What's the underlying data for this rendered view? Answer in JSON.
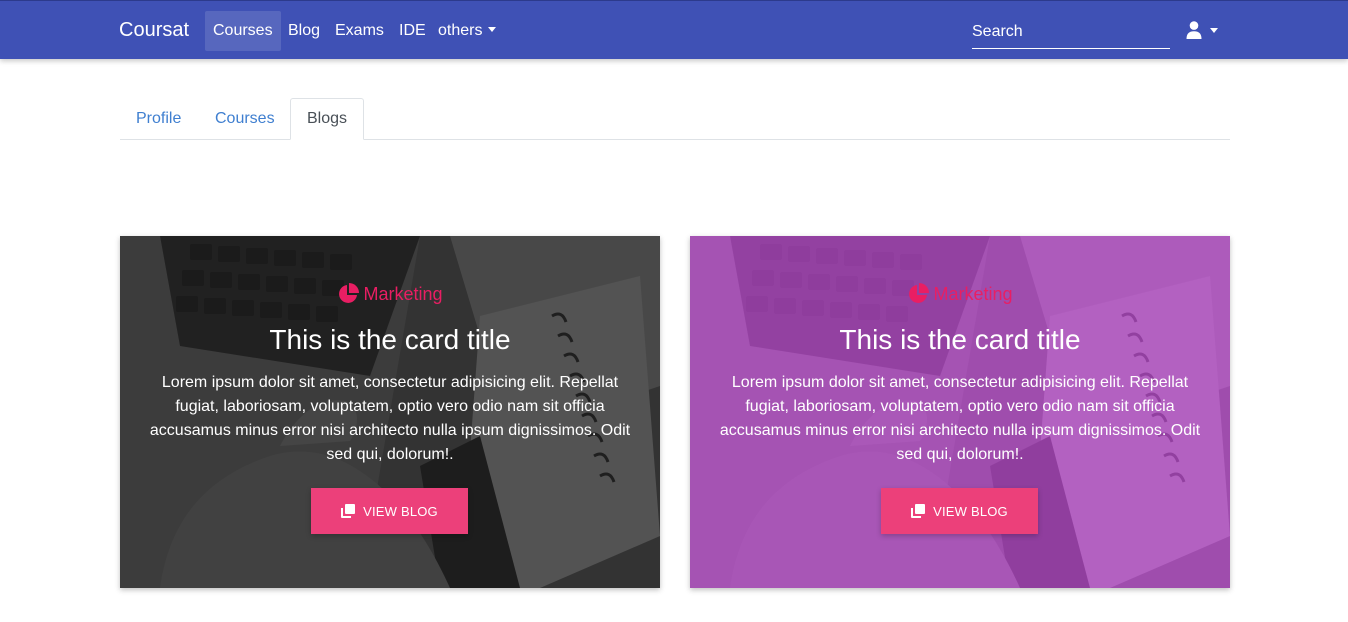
{
  "navbar": {
    "brand": "Coursat",
    "links": [
      "Courses",
      "Blog",
      "Exams",
      "IDE",
      "others"
    ],
    "search_placeholder": "Search",
    "icons": {
      "user": "user-icon",
      "dropdown": "caret-down-icon"
    },
    "colors": {
      "background": "#3f51b5"
    }
  },
  "tabs": [
    "Profile",
    "Courses",
    "Blogs"
  ],
  "active_tab": "Blogs",
  "cards": [
    {
      "category": "Marketing",
      "category_icon": "pie-chart-icon",
      "title": "This is the card title",
      "text": "Lorem ipsum dolor sit amet, consectetur adipisicing elit. Repellat fugiat, laboriosam, voluptatem, optio vero odio nam sit officia accusamus minus error nisi architecto nulla ipsum dignissimos. Odit sed qui, dolorum!.",
      "button_label": "VIEW BLOG",
      "button_icon": "copy-icon",
      "overlay_color": "#2b2b2b"
    },
    {
      "category": "Marketing",
      "category_icon": "pie-chart-icon",
      "title": "This is the card title",
      "text": "Lorem ipsum dolor sit amet, consectetur adipisicing elit. Repellat fugiat, laboriosam, voluptatem, optio vero odio nam sit officia accusamus minus error nisi architecto nulla ipsum dignissimos. Odit sed qui, dolorum!.",
      "button_label": "VIEW BLOG",
      "button_icon": "copy-icon",
      "overlay_color": "#ab47bc"
    }
  ],
  "colors": {
    "accent": "#ec407a",
    "category": "#e91e63",
    "tab_link": "#3f7fd0"
  }
}
